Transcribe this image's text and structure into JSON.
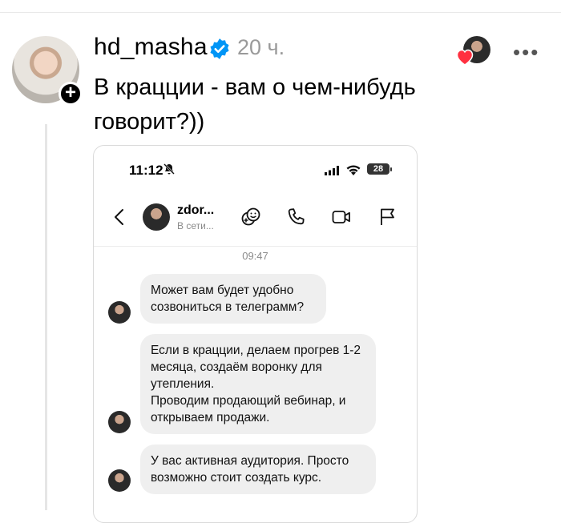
{
  "post": {
    "username": "hd_masha",
    "time": "20 ч.",
    "text": "В крацции - вам о чем-нибудь говорит?))"
  },
  "screenshot": {
    "status": {
      "time": "11:12",
      "battery": "28"
    },
    "chat": {
      "name": "zdor...",
      "status": "В сети..."
    },
    "time_label": "09:47",
    "messages": [
      {
        "text": "Может вам будет удобно созвониться в телеграмм?"
      },
      {
        "text": "Если в крацции, делаем прогрев 1-2 месяца, создаём воронку для утепления.\nПроводим продающий вебинар, и открываем продажи."
      },
      {
        "text": "У вас активная аудитория. Просто возможно стоит создать курс."
      }
    ]
  },
  "colors": {
    "verified": "#0095f6",
    "heart": "#ff3040",
    "bubble": "#efefef"
  }
}
